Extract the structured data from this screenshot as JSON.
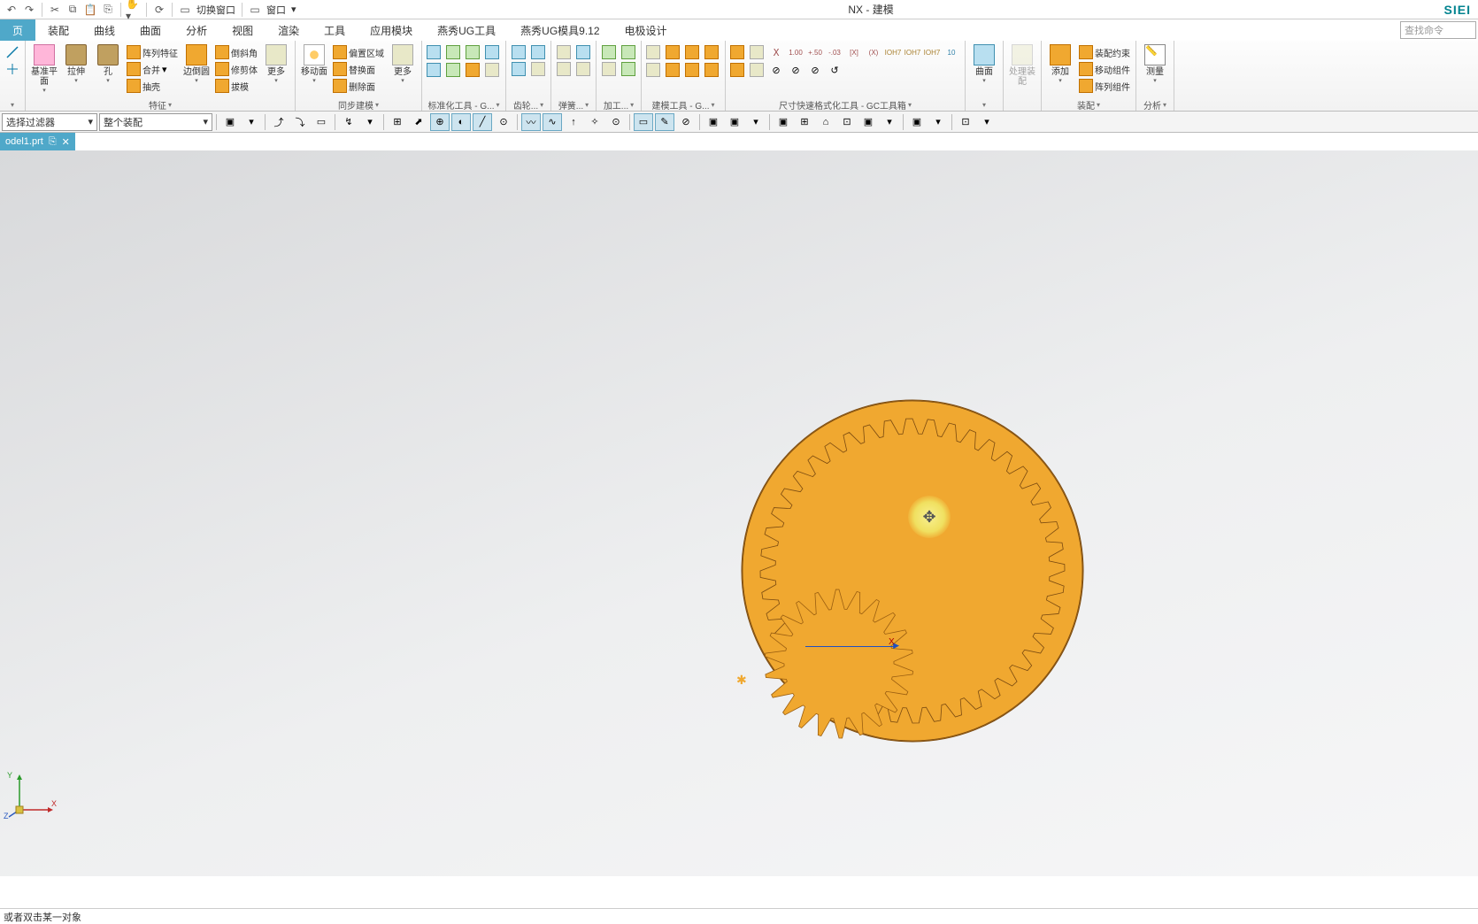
{
  "title": "NX - 建模",
  "brand": "SIEI",
  "qat": {
    "switch_window": "切换窗口",
    "window_menu": "窗口"
  },
  "search_placeholder": "查找命令",
  "tabs": [
    "页",
    "装配",
    "曲线",
    "曲面",
    "分析",
    "视图",
    "渲染",
    "工具",
    "应用模块",
    "燕秀UG工具",
    "燕秀UG模具9.12",
    "电极设计"
  ],
  "active_tab": 0,
  "groups": {
    "sketch": {
      "label": ""
    },
    "feature": {
      "label": "特征",
      "datum_plane": "基准平面",
      "extrude": "拉伸",
      "hole": "孔",
      "pattern": "阵列特征",
      "unite": "合并",
      "shell": "抽壳",
      "edge_blend": "边倒圆",
      "chamfer": "倒斜角",
      "trim_body": "修剪体",
      "draft": "拔模",
      "more": "更多"
    },
    "sync": {
      "label": "同步建模",
      "move_face": "移动面",
      "offset_region": "偏置区域",
      "replace_face": "替换面",
      "delete_face": "删除面",
      "more": "更多"
    },
    "std_tools": {
      "label": "标准化工具 - G..."
    },
    "gear": {
      "label": "齿轮..."
    },
    "spring": {
      "label": "弹簧..."
    },
    "machining": {
      "label": "加工..."
    },
    "build": {
      "label": "建模工具 - G..."
    },
    "size_tools": {
      "label": "尺寸快速格式化工具 - GC工具箱"
    },
    "surface": {
      "label": "",
      "btn": "曲面"
    },
    "finish": {
      "btn": "处理装配"
    },
    "assembly": {
      "label": "装配",
      "add": "添加",
      "constraint": "装配约束",
      "move_comp": "移动组件",
      "pattern_comp": "阵列组件"
    },
    "analysis": {
      "label": "分析",
      "measure": "测量"
    }
  },
  "filter": {
    "selection_filter": "选择过滤器",
    "assembly_filter": "整个装配"
  },
  "doc_tab": "odel1.prt",
  "status": "或者双击某一对象",
  "wcs": {
    "x": "X"
  },
  "triad": {
    "x": "X",
    "y": "Y",
    "z": "Z"
  }
}
